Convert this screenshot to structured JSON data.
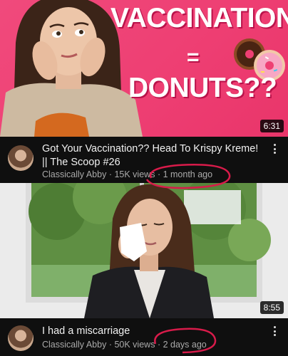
{
  "videos": [
    {
      "thumbnail_text_top": "VACCINATION",
      "thumbnail_text_mid": "=",
      "thumbnail_text_bottom": "DONUTS??",
      "duration": "6:31",
      "title": "Got Your Vaccination?? Head To Krispy Kreme! || The Scoop #26",
      "channel": "Classically Abby",
      "views": "15K views",
      "age": "1 month ago",
      "separator": "·"
    },
    {
      "duration": "8:55",
      "title": "I had a miscarriage",
      "channel": "Classically Abby",
      "views": "50K views",
      "age": "2 days ago",
      "separator": "·"
    }
  ],
  "colors": {
    "thumbnail_pink": "#ee3f73",
    "annotation_circle": "#d81b4a",
    "background": "#0f0f0f",
    "meta_gray": "#aaaaaa"
  },
  "icons": [
    "more-vert-icon"
  ]
}
